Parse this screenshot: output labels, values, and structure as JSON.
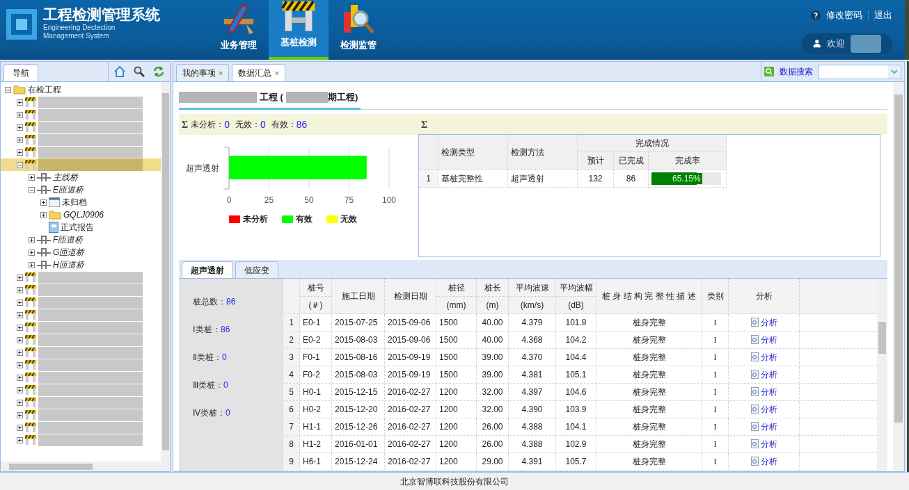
{
  "header": {
    "title": "工程检测管理系统",
    "subtitle_1": "Engineering Dectection",
    "subtitle_2": "Management System",
    "modules": [
      {
        "label": "业务管理",
        "kind": "pencil",
        "selected": false
      },
      {
        "label": "基桩检测",
        "kind": "barrier",
        "selected": true
      },
      {
        "label": "检测监管",
        "kind": "magnifier",
        "selected": false
      }
    ],
    "change_password": "修改密码",
    "logout": "退出",
    "welcome": "欢迎"
  },
  "sidebar": {
    "tab": "导航",
    "tree": [
      {
        "label": "在检工程",
        "kind": "folder",
        "expanded": true,
        "selected": false,
        "children": [
          {
            "kind": "blurred",
            "expanded": false,
            "selected": false
          },
          {
            "kind": "blurred",
            "expanded": false,
            "selected": false
          },
          {
            "kind": "blurred",
            "expanded": false,
            "selected": false
          },
          {
            "kind": "blurred",
            "expanded": false,
            "selected": false
          },
          {
            "kind": "blurred",
            "expanded": false,
            "selected": false
          },
          {
            "kind": "blurred",
            "expanded": true,
            "selected": true,
            "children": [
              {
                "label": "主线桥",
                "kind": "bridge",
                "expanded": false,
                "selected": false
              },
              {
                "label": "E匝道桥",
                "kind": "bridge",
                "expanded": true,
                "selected": false,
                "children": [
                  {
                    "label": "未归档",
                    "kind": "archive",
                    "expanded": false,
                    "selected": false
                  },
                  {
                    "label": "GQLJ0906",
                    "kind": "folder",
                    "expanded": false,
                    "selected": false
                  },
                  {
                    "label": "正式报告",
                    "kind": "report",
                    "selected": false
                  }
                ]
              },
              {
                "label": "F匝道桥",
                "kind": "bridge",
                "expanded": false,
                "selected": false
              },
              {
                "label": "G匝道桥",
                "kind": "bridge",
                "expanded": false,
                "selected": false
              },
              {
                "label": "H匝道桥",
                "kind": "bridge",
                "expanded": false,
                "selected": false
              }
            ]
          },
          {
            "kind": "blurred",
            "expanded": false,
            "selected": false
          },
          {
            "kind": "blurred",
            "expanded": false,
            "selected": false
          },
          {
            "kind": "blurred",
            "expanded": false,
            "selected": false
          },
          {
            "kind": "blurred",
            "expanded": false,
            "selected": false
          },
          {
            "kind": "blurred",
            "expanded": false,
            "selected": false
          },
          {
            "kind": "blurred",
            "expanded": false,
            "selected": false
          },
          {
            "kind": "blurred",
            "expanded": false,
            "selected": false
          },
          {
            "kind": "blurred",
            "expanded": false,
            "selected": false
          },
          {
            "kind": "blurred",
            "expanded": false,
            "selected": false
          },
          {
            "kind": "blurred",
            "expanded": false,
            "selected": false
          },
          {
            "kind": "blurred",
            "expanded": false,
            "selected": false
          },
          {
            "kind": "blurred",
            "expanded": false,
            "selected": false
          },
          {
            "kind": "blurred",
            "expanded": false,
            "selected": false
          },
          {
            "kind": "blurred",
            "expanded": false,
            "selected": false
          }
        ]
      }
    ]
  },
  "tabs": [
    {
      "label": "我的事项",
      "close": "×",
      "selected": false
    },
    {
      "label": "数据汇总",
      "close": "×",
      "selected": true
    }
  ],
  "search": {
    "label": "数据搜索"
  },
  "project_title": {
    "part_1": "工程 (",
    "part_2": "期工程)"
  },
  "summary": {
    "sigma": "Σ",
    "items": [
      {
        "label": "未分析：",
        "value": "0"
      },
      {
        "label": "无效：",
        "value": "0"
      },
      {
        "label": "有效：",
        "value": "86"
      }
    ]
  },
  "chart": {
    "chart_data": {
      "type": "bar",
      "orientation": "horizontal",
      "stacked": true,
      "categories": [
        "超声透射"
      ],
      "series": [
        {
          "name": "未分析",
          "color": "#ff0000",
          "values": [
            0
          ]
        },
        {
          "name": "有效",
          "color": "#00ff00",
          "values": [
            86
          ]
        },
        {
          "name": "无效",
          "color": "#ffff00",
          "values": [
            0
          ]
        }
      ],
      "xlim": [
        0,
        100
      ],
      "xticks": [
        0,
        25,
        50,
        75,
        100
      ],
      "grid": true
    }
  },
  "progress_table": {
    "sigma": "Σ",
    "columns": [
      "检测类型",
      "检测方法"
    ],
    "group": "完成情况",
    "subcolumns": [
      "预计",
      "已完成",
      "完成率"
    ],
    "rows": [
      {
        "index": "1",
        "type": "基桩完整性",
        "method": "超声透射",
        "planned": "132",
        "done": "86",
        "rate": "65.15%",
        "level": 0.6515
      }
    ]
  },
  "method_tabs": [
    {
      "label": "超声透射",
      "selected": true
    },
    {
      "label": "低应变",
      "selected": false
    }
  ],
  "pile_stats": [
    {
      "label": "桩总数：",
      "value": "86"
    },
    {
      "label": "Ⅰ类桩：",
      "value": "86"
    },
    {
      "label": "Ⅱ类桩：",
      "value": "0"
    },
    {
      "label": "Ⅲ类桩：",
      "value": "0"
    },
    {
      "label": "Ⅳ类桩：",
      "value": "0"
    }
  ],
  "pile_table": {
    "columns": [
      {
        "label": "桩号",
        "unit": "(＃)"
      },
      {
        "label": "施工日期"
      },
      {
        "label": "检测日期"
      },
      {
        "label": "桩径",
        "unit": "(mm)"
      },
      {
        "label": "桩长",
        "unit": "(m)"
      },
      {
        "label": "平均波速",
        "unit": "(km/s)"
      },
      {
        "label": "平均波幅",
        "unit": "(dB)"
      },
      {
        "label": "桩 身 结 构 完 整 性 描 述"
      },
      {
        "label": "类别"
      },
      {
        "label": "分析"
      }
    ],
    "rows": [
      {
        "index": "1",
        "cells": [
          "E0-1",
          "2015-07-25",
          "2015-09-06",
          "1500",
          "40.00",
          "4.379",
          "101.8",
          "桩身完整",
          "I",
          "分析"
        ]
      },
      {
        "index": "2",
        "cells": [
          "E0-2",
          "2015-08-03",
          "2015-09-06",
          "1500",
          "40.00",
          "4.368",
          "104.2",
          "桩身完整",
          "I",
          "分析"
        ]
      },
      {
        "index": "3",
        "cells": [
          "F0-1",
          "2015-08-16",
          "2015-09-19",
          "1500",
          "39.00",
          "4.370",
          "104.4",
          "桩身完整",
          "I",
          "分析"
        ]
      },
      {
        "index": "4",
        "cells": [
          "F0-2",
          "2015-08-03",
          "2015-09-19",
          "1500",
          "39.00",
          "4.381",
          "105.1",
          "桩身完整",
          "I",
          "分析"
        ]
      },
      {
        "index": "5",
        "cells": [
          "H0-1",
          "2015-12-15",
          "2016-02-27",
          "1200",
          "32.00",
          "4.397",
          "104.6",
          "桩身完整",
          "I",
          "分析"
        ]
      },
      {
        "index": "6",
        "cells": [
          "H0-2",
          "2015-12-20",
          "2016-02-27",
          "1200",
          "32.00",
          "4.390",
          "103.9",
          "桩身完整",
          "I",
          "分析"
        ]
      },
      {
        "index": "7",
        "cells": [
          "H1-1",
          "2015-12-26",
          "2016-02-27",
          "1200",
          "26.00",
          "4.388",
          "104.1",
          "桩身完整",
          "I",
          "分析"
        ]
      },
      {
        "index": "8",
        "cells": [
          "H1-2",
          "2016-01-01",
          "2016-02-27",
          "1200",
          "26.00",
          "4.388",
          "102.9",
          "桩身完整",
          "I",
          "分析"
        ]
      },
      {
        "index": "9",
        "cells": [
          "H6-1",
          "2015-12-24",
          "2016-02-27",
          "1200",
          "29.00",
          "4.391",
          "105.7",
          "桩身完整",
          "I",
          "分析"
        ]
      }
    ]
  },
  "footer": "北京智博联科技股份有限公司"
}
